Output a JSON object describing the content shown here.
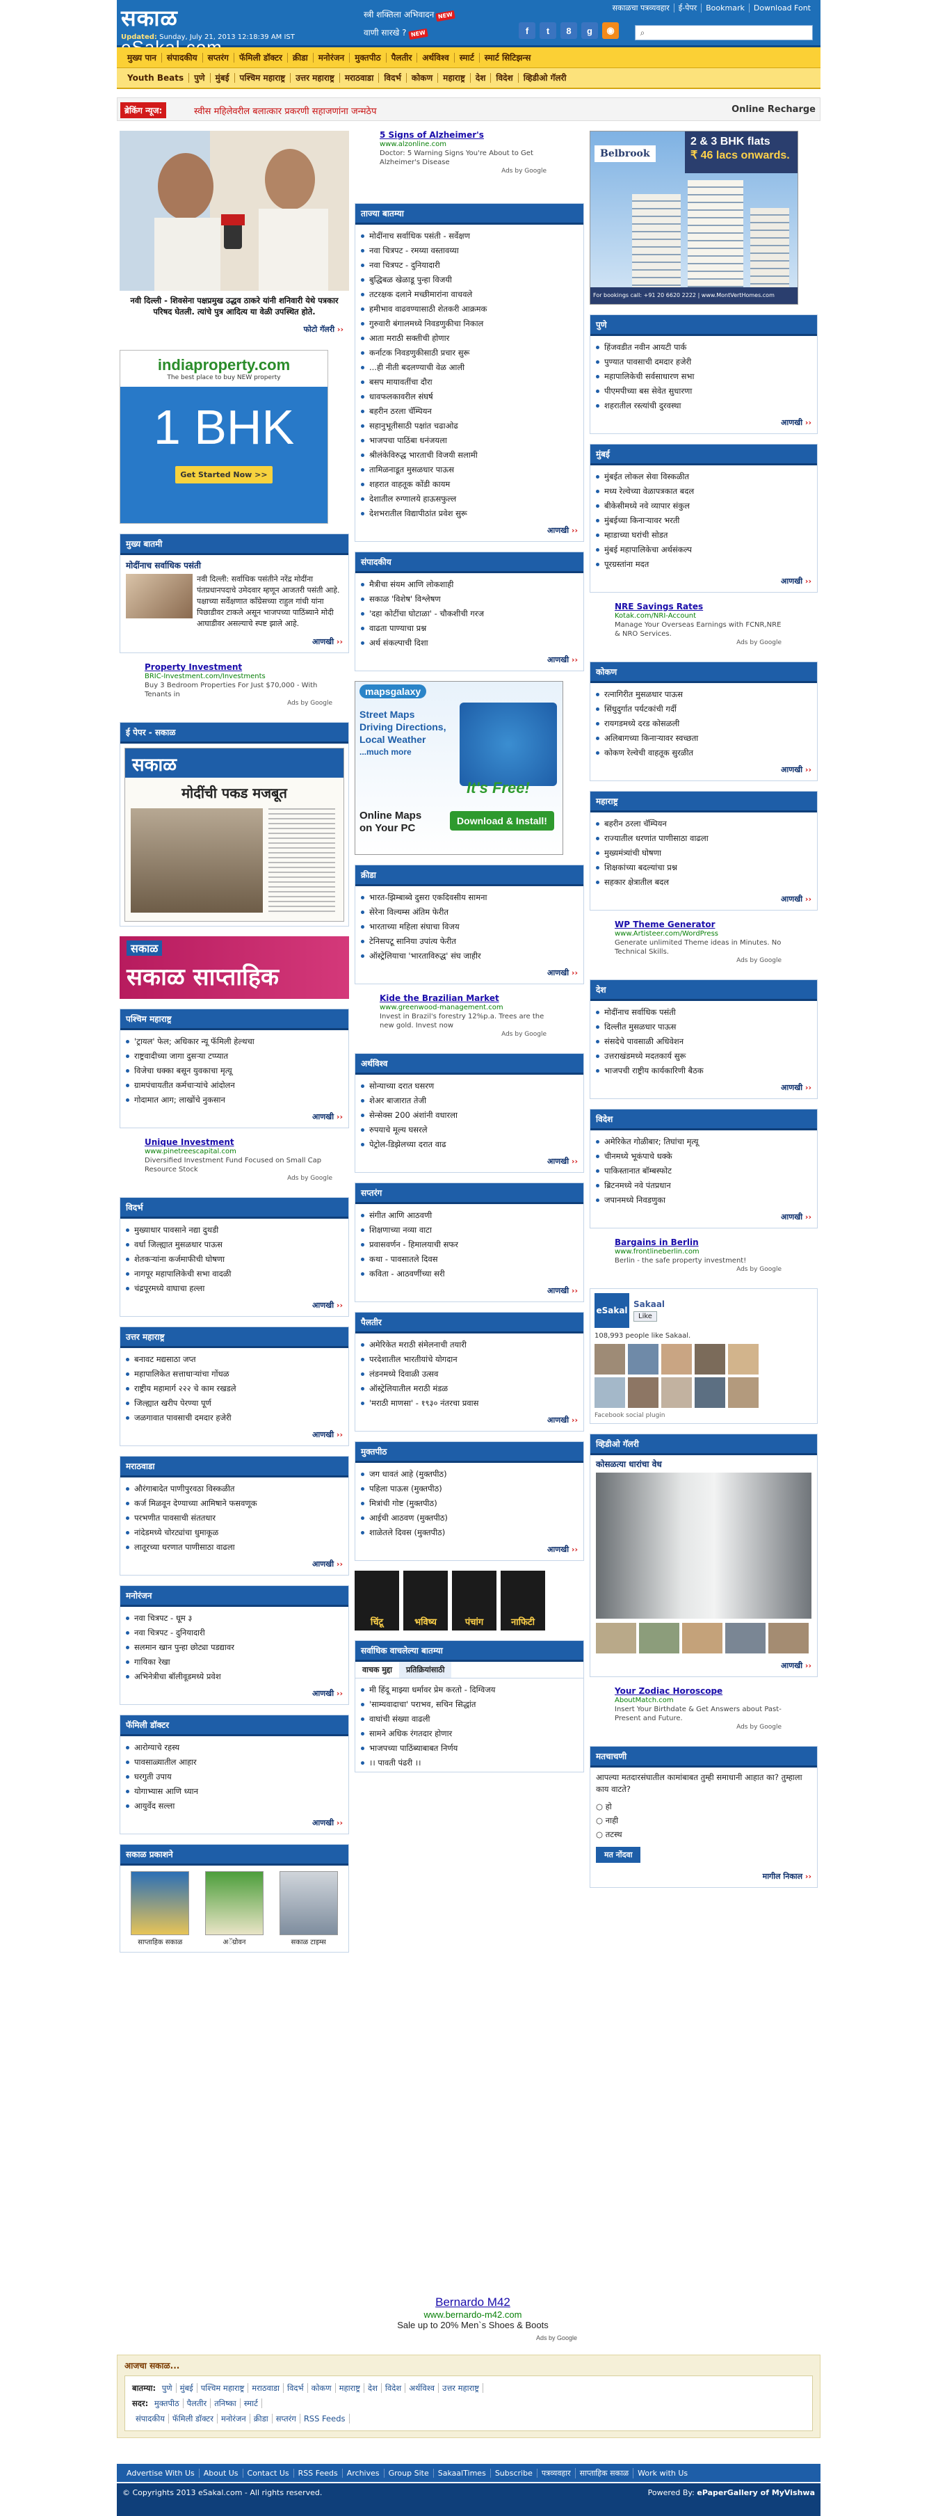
{
  "header": {
    "logo_marathi": "सकाळ",
    "logo_domain": "eSakal.com",
    "updated_label": "Updated:",
    "updated_value": "Sunday, July 21, 2013 12:18:39 AM IST",
    "promo1": "स्त्री शक्तिला अभिवादन",
    "promo2": "वाणी सारखे ?",
    "top_links": [
      "सकाळचा पत्रव्यवहार",
      "ई-पेपर",
      "Bookmark",
      "Download Font"
    ],
    "search_placeholder": ""
  },
  "nav1": [
    "मुख्य पान",
    "संपादकीय",
    "सप्तरंग",
    "फॅमिली डॉक्टर",
    "क्रीडा",
    "मनोरंजन",
    "मुक्तपीठ",
    "पैलतीर",
    "अर्थविश्व",
    "स्मार्ट",
    "स्मार्ट सिटिझन्स"
  ],
  "nav2": [
    "Youth Beats",
    "पुणे",
    "मुंबई",
    "पश्चिम महाराष्ट्र",
    "उत्तर महाराष्ट्र",
    "मराठवाडा",
    "विदर्भ",
    "कोकण",
    "महाराष्ट्र",
    "देश",
    "विदेश",
    "व्हिडीओ गॅलरी"
  ],
  "ticker": {
    "label": "ब्रेकिंग न्यूज:",
    "text": "स्वीस महिलेवरील बलात्कार प्रकरणी सहाजणांना जन्मठेप",
    "right": "Online Recharge"
  },
  "left": {
    "hero_caption": "नवी दिल्ली - शिवसेना पक्षप्रमुख उद्धव ठाकरे यांनी शनिवारी येथे पत्रकार परिषद घेतली. त्यांचे पुत्र आदित्य या वेळी उपस्थित होते.",
    "photo_gallery": "फोटो गॅलरी",
    "ad_indiaproperty": {
      "brand": "indiaproperty.com",
      "tag": "The best place to buy NEW property",
      "big": "1 BHK",
      "btn": "Get Started Now >>"
    },
    "main_news": {
      "title": "मुख्य बातमी",
      "headline": "मोदींनाच सर्वाधिक पसंती",
      "body": "नवी दिल्ली: सर्वाधिक पसंतीने नरेंद्र मोदींना पंतप्रधानपदाचे उमेदवार म्हणून आजतरी पसंती आहे. पक्षाच्या सर्वेक्षणात काँग्रेसच्या राहुल गांधी यांना पिछाडीवर टाकले असून भाजपच्या पाठिंब्याने मोदी आघाडीवर असल्याचे स्पष्ट झाले आहे.",
      "more": "आणखी"
    },
    "ad_property": {
      "title": "Property Investment",
      "url": "BRIC-Investment.com/Investments",
      "desc": "Buy 3 Bedroom Properties For Just $70,000 - With Tenants in",
      "g": "Ads by Google"
    },
    "epaper": {
      "title": "ई पेपर - सकाळ",
      "headline": "मोदींची पकड मजबूत"
    },
    "saptahik": "सकाळ साप्ताहिक",
    "paschim": {
      "title": "पश्चिम महाराष्ट्र",
      "items": [
        "'ट्रायल' फेल; अधिकार न्यू फॅमिली हेल्थचा",
        "राष्ट्रवादीच्या जागा दुसऱ्या टप्प्यात",
        "विजेचा धक्का बसून युवकाचा मृत्यू",
        "ग्रामपंचायतीत कर्मचाऱ्यांचे आंदोलन",
        "गोदामात आग; लाखोंचे नुकसान"
      ],
      "more": "आणखी"
    },
    "ad_unique": {
      "title": "Unique Investment",
      "url": "www.pinetreescapital.com",
      "desc": "Diversified Investment Fund Focused on Small Cap Resource Stock",
      "g": "Ads by Google"
    },
    "vidarbha": {
      "title": "विदर्भ",
      "items": [
        "मुख्याधार पावसाने नद्या दुथडी",
        "वर्धा जिल्ह्यात मुसळधार पाऊस",
        "शेतकऱ्यांना कर्जमाफीची घोषणा",
        "नागपूर महापालिकेची सभा वादळी",
        "चंद्रपूरमध्ये वाघाचा हल्ला"
      ],
      "more": "आणखी"
    },
    "uttar": {
      "title": "उत्तर महाराष्ट्र",
      "items": [
        "बनावट मद्यसाठा जप्त",
        "महापालिकेत सत्ताधाऱ्यांचा गोंधळ",
        "राष्ट्रीय महामार्ग २२२ चे काम रखडले",
        "जिल्ह्यात खरीप पेरण्या पूर्ण",
        "जळगावात पावसाची दमदार हजेरी"
      ],
      "more": "आणखी"
    },
    "marathwada": {
      "title": "मराठवाडा",
      "items": [
        "औरंगाबादेत पाणीपुरवठा विस्कळीत",
        "कर्ज मिळवून देण्याच्या आमिषाने फसवणूक",
        "परभणीत पावसाची संततधार",
        "नांदेडमध्ये चोरट्यांचा धुमाकूळ",
        "लातूरच्या धरणात पाणीसाठा वाढला"
      ],
      "more": "आणखी"
    },
    "manoranjan": {
      "title": "मनोरंजन",
      "items": [
        "नवा चित्रपट - धूम ३",
        "नवा चित्रपट - दुनियादारी",
        "सलमान खान पुन्हा छोट्या पडद्यावर",
        "गायिका रेखा",
        "अभिनेत्रीचा बॉलीवूडमध्ये प्रवेश"
      ],
      "more": "आणखी"
    },
    "family": {
      "title": "फॅमिली डॉक्टर",
      "items": [
        "आरोग्याचे रहस्य",
        "पावसाळ्यातील आहार",
        "घरगुती उपाय",
        "योगाभ्यास आणि ध्यान",
        "आयुर्वेद सल्ला"
      ],
      "more": "आणखी"
    },
    "prakashane": {
      "title": "सकाळ प्रकाशने",
      "items": [
        "साप्ताहिक सकाळ",
        "अॅग्रोवन",
        "सकाळ टाइम्स"
      ]
    }
  },
  "mid": {
    "ad_alz": {
      "title": "5 Signs of Alzheimer's",
      "url": "www.alzonline.com",
      "desc": "Doctor: 5 Warning Signs You're About to Get Alzheimer's Disease",
      "g": "Ads by Google"
    },
    "latest": {
      "title": "ताज्या बातम्या",
      "items": [
        "मोदींनाच सर्वाधिक पसंती - सर्वेक्षण",
        "नवा चित्रपट - रमय्या वस्तावय्या",
        "नवा चित्रपट - दुनियादारी",
        "बुद्धिबळ खेळाडू पुन्हा विजयी",
        "तटरक्षक दलाने मच्छीमारांना वाचवले",
        "हमीभाव वाढवण्यासाठी शेतकरी आक्रमक",
        "गुरुवारी बंगालमध्ये निवडणुकीचा निकाल",
        "आता मराठी सक्तीची होणार",
        "कर्नाटक निवडणुकीसाठी प्रचार सुरू",
        "...ही नीती बदलण्याची वेळ आली",
        "बसप मायावतींचा दौरा",
        "धावफलकावरील संघर्ष",
        "बहरीन ठरला चॅम्पियन",
        "सहानुभूतीसाठी पक्षांत चढाओढ",
        "भाजपचा पाठिंबा धनंजयला",
        "श्रीलंकेविरुद्ध भारताची विजयी सलामी",
        "तामिळनाडूत मुसळधार पाऊस",
        "शहरात वाहतूक कोंडी कायम",
        "देशातील रुग्णालये हाऊसफुल्ल",
        "देशभरातील विद्यापीठांत प्रवेश सुरू"
      ],
      "more": "आणखी"
    },
    "editorial": {
      "title": "संपादकीय",
      "items": [
        "मैत्रीचा संयम आणि लोकशाही",
        "सकाळ 'विशेष' विश्लेषण",
        "'दहा कोटींचा घोटाळा' - चौकशीची गरज",
        "वाढता पाण्याचा प्रश्न",
        "अर्थ संकल्पाची दिशा"
      ],
      "more": "आणखी"
    },
    "ad_maps": {
      "brand": "mapsgalaxy",
      "line1": "Street Maps",
      "line2": "Driving Directions,",
      "line3": "Local Weather",
      "line4": "...much more",
      "free": "It's Free!",
      "online": "Online Maps",
      "onpc": "on Your PC",
      "dl": "Download & Install!"
    },
    "sport": {
      "title": "क्रीडा",
      "items": [
        "भारत-झिम्बाब्वे दुसरा एकदिवसीय सामना",
        "सेरेना विल्यम्स अंतिम फेरीत",
        "भारताच्या महिला संघाचा विजय",
        "टेनिसपटू सानिया उपांत्य फेरीत",
        "ऑस्ट्रेलियाचा 'भारताविरुद्ध' संघ जाहीर"
      ],
      "more": "आणखी"
    },
    "ad_kide": {
      "title": "Kide the Brazilian Market",
      "url": "www.greenwood-management.com",
      "desc": "Invest in Brazil's forestry 12%p.a. Trees are the new gold. Invest now",
      "g": "Ads by Google"
    },
    "arthavishwa": {
      "title": "अर्थविश्व",
      "items": [
        "सोन्याच्या दरात घसरण",
        "शेअर बाजारात तेजी",
        "सेन्सेक्स 200 अंशांनी वधारला",
        "रुपयाचे मूल्य घसरले",
        "पेट्रोल-डिझेलच्या दरात वाढ"
      ],
      "more": "आणखी"
    },
    "saptarang": {
      "title": "सप्तरंग",
      "items": [
        "संगीत आणि आठवणी",
        "शिक्षणाच्या नव्या वाटा",
        "प्रवासवर्णन - हिमालयाची सफर",
        "कथा - पावसातले दिवस",
        "कविता - आठवणींच्या सरी"
      ],
      "more": "आणखी"
    },
    "pailtir": {
      "title": "पैलतीर",
      "items": [
        "अमेरिकेत मराठी संमेलनाची तयारी",
        "परदेशातील भारतीयांचे योगदान",
        "लंडनमध्ये दिवाळी उत्सव",
        "ऑस्ट्रेलियातील मराठी मंडळ",
        "'मराठी माणसा' - १९३० नंतरचा प्रवास"
      ],
      "more": "आणखी"
    },
    "muktapeeth": {
      "title": "मुक्तपीठ",
      "items": [
        "जग धावतं आहे (मुक्तपीठ)",
        "पहिला पाऊस (मुक्तपीठ)",
        "मित्रांची गोष्ट (मुक्तपीठ)",
        "आईची आठवण (मुक्तपीठ)",
        "शाळेतले दिवस (मुक्तपीठ)"
      ],
      "more": "आणखी"
    },
    "tabs": [
      "चिंटू",
      "भविष्य",
      "पंचांग",
      "नाफिटी"
    ],
    "most": {
      "title": "सर्वाधिक वाचलेल्या बातम्या",
      "tabs": [
        "वाचक मुद्दा",
        "प्रतिक्रियांसाठी"
      ],
      "items": [
        "मी हिंदू माझ्या धर्मावर प्रेम करतो - दिग्विजय",
        "'साम्यवादाचा' पराभव, सचिन सिद्धांत",
        "वाघांची संख्या वाढली",
        "सामने अधिक रंगतदार होणार",
        "भाजपच्या पाठिंब्याबाबत निर्णय",
        "।। पावती पंढरी ।।"
      ]
    }
  },
  "right": {
    "ad_flats": {
      "brand": "Belbrook",
      "line1": "2 & 3 BHK flats",
      "line2": "₹ 46 lacs onwards.",
      "foot": "For bookings call: +91 20 6620 2222 | www.MontVertHomes.com"
    },
    "pune": {
      "title": "पुणे",
      "items": [
        "हिंजवडीत नवीन आयटी पार्क",
        "पुण्यात पावसाची दमदार हजेरी",
        "महापालिकेची सर्वसाधारण सभा",
        "पीएमपीच्या बस सेवेत सुधारणा",
        "शहरातील रस्त्यांची दुरवस्था"
      ],
      "more": "आणखी"
    },
    "mumbai": {
      "title": "मुंबई",
      "items": [
        "मुंबईत लोकल सेवा विस्कळीत",
        "मध्य रेल्वेच्या वेळापत्रकात बदल",
        "बीकेसीमध्ये नवे व्यापार संकुल",
        "मुंबईच्या किनाऱ्यावर भरती",
        "म्हाडाच्या घरांची सोडत",
        "मुंबई महापालिकेचा अर्थसंकल्प",
        "पूरग्रस्तांना मदत"
      ],
      "more": "आणखी"
    },
    "ad_nre": {
      "title": "NRE Savings Rates",
      "url": "Kotak.com/NRI-Account",
      "desc": "Manage Your Overseas Earnings with FCNR,NRE & NRO Services.",
      "g": "Ads by Google"
    },
    "kokan": {
      "title": "कोकण",
      "items": [
        "रत्नागिरीत मुसळधार पाऊस",
        "सिंधुदुर्गात पर्यटकांची गर्दी",
        "रायगडमध्ये दरड कोसळली",
        "अलिबागच्या किनाऱ्यावर स्वच्छता",
        "कोकण रेल्वेची वाहतूक सुरळीत"
      ],
      "more": "आणखी"
    },
    "maharashtra": {
      "title": "महाराष्ट्र",
      "items": [
        "बहरीन ठरला चॅम्पियन",
        "राज्यातील धरणांत पाणीसाठा वाढला",
        "मुख्यमंत्र्यांची घोषणा",
        "शिक्षकांच्या बदल्यांचा प्रश्न",
        "सहकार क्षेत्रातील बदल"
      ],
      "more": "आणखी"
    },
    "ad_wp": {
      "title": "WP Theme Generator",
      "url": "www.Artisteer.com/WordPress",
      "desc": "Generate unlimited Theme ideas in Minutes. No Technical Skills.",
      "g": "Ads by Google"
    },
    "desh": {
      "title": "देश",
      "items": [
        "मोदींनाच सर्वाधिक पसंती",
        "दिल्लीत मुसळधार पाऊस",
        "संसदेचे पावसाळी अधिवेशन",
        "उत्तराखंडमध्ये मदतकार्य सुरू",
        "भाजपची राष्ट्रीय कार्यकारिणी बैठक"
      ],
      "more": "आणखी"
    },
    "videsh": {
      "title": "विदेश",
      "items": [
        "अमेरिकेत गोळीबार; तिघांचा मृत्यू",
        "चीनमध्ये भूकंपाचे धक्के",
        "पाकिस्तानात बॉम्बस्फोट",
        "ब्रिटनमध्ये नवे पंतप्रधान",
        "जपानमध्ये निवडणुका"
      ],
      "more": "आणखी"
    },
    "ad_berlin": {
      "title": "Bargains in Berlin",
      "url": "www.frontlineberlin.com",
      "desc": "Berlin - the safe property investment!",
      "g": "Ads by Google"
    },
    "fb": {
      "brand": "eSakal",
      "name": "Sakaal",
      "like": "Like",
      "count": "108,993 people like Sakaal.",
      "plugin": "Facebook social plugin"
    },
    "video": {
      "title": "व्हिडीओ गॅलरी",
      "caption": "कोसळत्या धारांचा वेध",
      "more": "आणखी"
    },
    "ad_zodiac": {
      "title": "Your Zodiac Horoscope",
      "url": "AboutMatch.com",
      "desc": "Insert Your Birthdate & Get Answers about Past-Present and Future.",
      "g": "Ads by Google"
    },
    "poll": {
      "title": "मतचाचणी",
      "question": "आपल्या मतदारसंघातील कामांबाबत तुम्ही समाधानी आहात का? तुम्हाला काय वाटते?",
      "options": [
        "हो",
        "नाही",
        "तटस्थ"
      ],
      "btn": "मत नोंदवा",
      "prev": "मागील निकाल"
    }
  },
  "bottom_ad": {
    "title": "Bernardo M42",
    "url": "www.bernardo-m42.com",
    "desc": "Sale up to 20% Men`s Shoes & Boots",
    "g": "Ads by Google"
  },
  "footer": {
    "title": "आजचा सकाळ...",
    "row1_label": "बातम्या:",
    "row1": [
      "पुणे",
      "मुंबई",
      "पश्चिम महाराष्ट्र",
      "मराठवाडा",
      "विदर्भ",
      "कोकण",
      "महाराष्ट्र",
      "देश",
      "विदेश",
      "अर्थविश्व",
      "उत्तर महाराष्ट्र"
    ],
    "row2_label": "सदर:",
    "row2": [
      "मुक्तपीठ",
      "पैलतीर",
      "तनिष्का",
      "स्मार्ट"
    ],
    "row3": [
      "संपादकीय",
      "फॅमिली डॉक्टर",
      "मनोरंजन",
      "क्रीडा",
      "सप्तरंग",
      "RSS Feeds"
    ],
    "links": [
      "Advertise With Us",
      "About Us",
      "Contact Us",
      "RSS Feeds",
      "Archives",
      "Group Site",
      "SakaalTimes",
      "Subscribe",
      "पत्रव्यवहार",
      "साप्ताहिक सकाळ",
      "Work with Us"
    ],
    "copyright": "© Copyrights 2013 eSakal.com - All rights reserved.",
    "powered": "Powered By:",
    "powered_by": "ePaperGallery of MyVishwa"
  }
}
